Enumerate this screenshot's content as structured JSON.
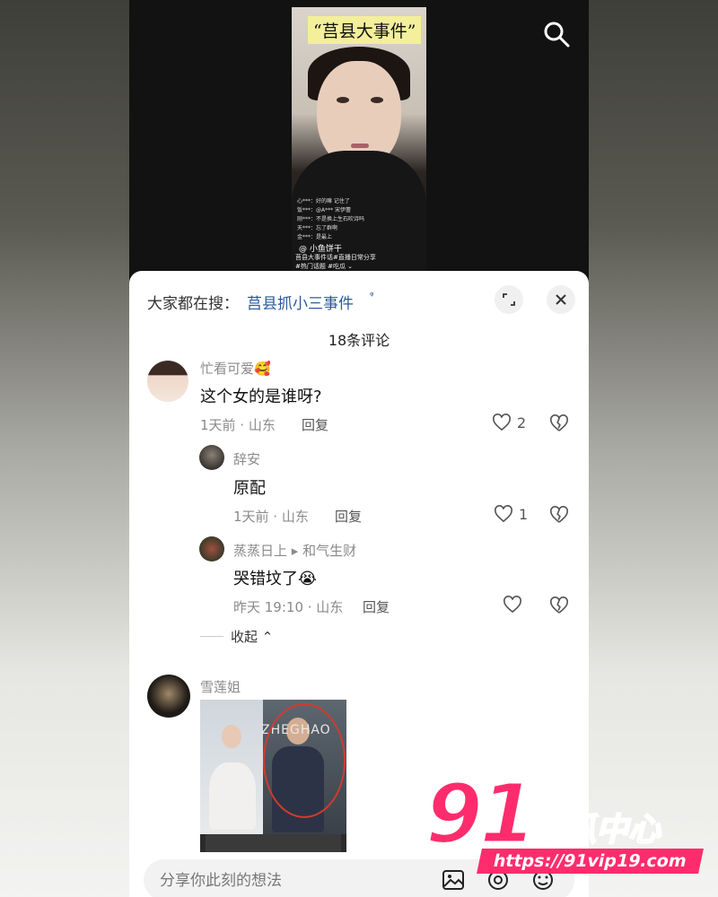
{
  "video": {
    "caption": "“莒县大事件”",
    "live_lines": [
      "心***：好的嘛 记住了",
      "饭***：@A*** 宋伊蕾",
      "刚***：不是换上生石吹诗吗",
      "天***：忘了群啊",
      "金***：是最上"
    ],
    "live_user": "@ 小鱼饼干",
    "live_tags": [
      "莒县大事件话#直播日常分享",
      "#热门话题 #吃瓜 ⌄"
    ]
  },
  "sheet": {
    "suggest_prefix": "大家都在搜：",
    "suggest_query": "莒县抓小三事件",
    "suggest_glyph": "ᵠ",
    "comment_count_title": "18条评论"
  },
  "comments": [
    {
      "username": "忙看可爱🥰",
      "text": "这个女的是谁呀?",
      "meta": "1天前 · 山东",
      "reply": "回复",
      "likes": "2"
    },
    {
      "username": "辞安",
      "text": "原配",
      "meta": "1天前 · 山东",
      "reply": "回复",
      "likes": "1"
    },
    {
      "username": "蒸蒸日上 ▸ 和气生财",
      "text": "哭错坟了😭",
      "meta": "昨天 19:10 · 山东",
      "reply": "回复",
      "likes": ""
    },
    {
      "username": "雪莲姐",
      "photo_sign": "ZHEGHAO"
    }
  ],
  "collapse_label": "收起 ⌃",
  "input": {
    "placeholder": "分享你此刻的想法"
  },
  "watermark": {
    "logo_number": "91",
    "logo_text": "吃瓜中心",
    "url": "https://91vip19.com"
  },
  "colors": {
    "link": "#2a5a9a",
    "watermark_pink": "#ff2c6d"
  }
}
